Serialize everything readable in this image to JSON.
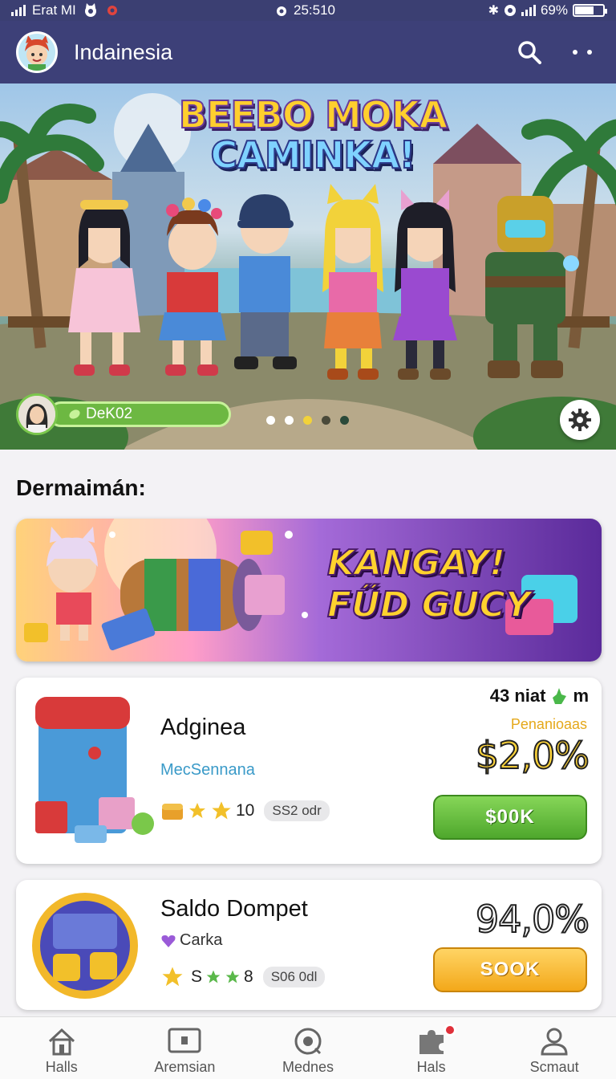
{
  "status_bar": {
    "carrier": "Erat MI",
    "time": "25:510",
    "battery": "69%",
    "battery_level": 0.69
  },
  "header": {
    "title": "Indainesia",
    "search_icon": "search-icon",
    "more_icon": "more-icon"
  },
  "hero": {
    "title_line1": "BEEBO MOKA",
    "title_line2": "CAMINKA!",
    "profile_name": "DeK02",
    "carousel_dots": 5,
    "active_dot": 2
  },
  "section": {
    "title": "Dermaimán:"
  },
  "promo": {
    "line1": "KANGAY!",
    "line2": "FŰD GUCY"
  },
  "offers": [
    {
      "name": "Adginea",
      "subtitle": "MecSennana",
      "rating_count": "10",
      "chip": "SS2 odr",
      "meta": "43 niat",
      "meta_suffix": "m",
      "percent_label": "Penanioaas",
      "percent": "$2,0%",
      "button": "$00K"
    },
    {
      "name": "Saldo Dompet",
      "subtitle": "Carka",
      "rating_prefix": "S",
      "rating_count": "8",
      "chip": "S06 0dl",
      "percent": "94,0%",
      "button": "SOOK"
    }
  ],
  "nav": [
    {
      "label": "Halls",
      "icon": "home-icon"
    },
    {
      "label": "Aremsian",
      "icon": "tv-icon"
    },
    {
      "label": "Mednes",
      "icon": "compass-icon"
    },
    {
      "label": "Hals",
      "icon": "puzzle-icon"
    },
    {
      "label": "Scmaut",
      "icon": "user-icon"
    }
  ],
  "colors": {
    "header_bg": "#3d4078",
    "green_button": "#5db53a",
    "orange_button": "#f6b72a",
    "promo_purple": "#6a34a8"
  }
}
